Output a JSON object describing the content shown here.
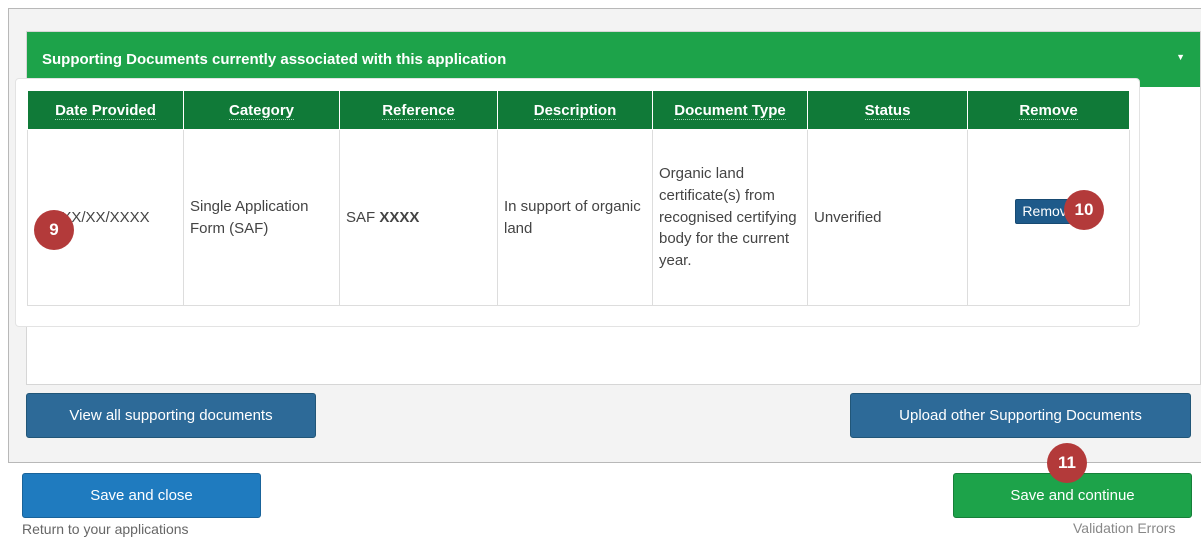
{
  "panel": {
    "title": "Supporting Documents currently associated with this application",
    "caret": "▼"
  },
  "table": {
    "headers": [
      "Date Provided",
      "Category",
      "Reference",
      "Description",
      "Document Type",
      "Status",
      "Remove"
    ],
    "row": {
      "date": "XX/XX/XXXX",
      "category": "Single Application Form (SAF)",
      "reference_prefix": "SAF ",
      "reference_bold": "XXXX",
      "description": "In support of organic land",
      "document_type": "Organic land certificate(s) from recognised certifying body for the current year.",
      "status": "Unverified",
      "remove_label": "Remove"
    }
  },
  "buttons": {
    "view_all": "View all supporting documents",
    "upload_other": "Upload other Supporting Documents",
    "save_close": "Save and close",
    "save_continue": "Save and continue"
  },
  "subtext": {
    "return": "Return to your applications",
    "validation": "Validation Errors"
  },
  "annotations": {
    "badge_9": "9",
    "badge_10": "10",
    "badge_11": "11"
  },
  "colors": {
    "panel_header": "#1da34a",
    "table_header": "#107a38",
    "link_blue": "#2a7ec0",
    "button_blue": "#2d6a98",
    "save_close_blue": "#1f7bbf",
    "save_continue_green": "#1da34a",
    "badge_red": "#b33a3a"
  }
}
